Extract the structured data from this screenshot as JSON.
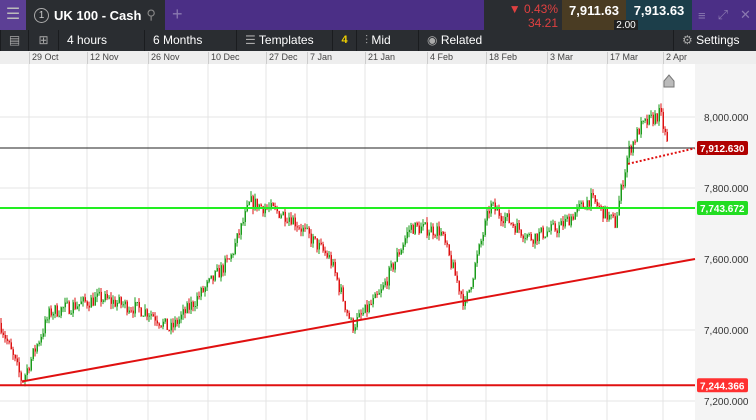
{
  "header": {
    "menu_icon": "hamburger-icon",
    "tab_number": "1",
    "tab_title": "UK 100 - Cash",
    "change_pct": "▼ 0.43%",
    "change_pts": "34.21",
    "sell": "7,911.63",
    "buy": "7,913.63",
    "spread": "2.00"
  },
  "toolbar": {
    "interval": "4 hours",
    "range": "6 Months",
    "templates": "Templates",
    "templates_count": "4",
    "price_type": "Mid",
    "related": "Related",
    "settings": "Settings"
  },
  "dates": [
    "29 Oct",
    "12 Nov",
    "26 Nov",
    "10 Dec",
    "27 Dec",
    "7 Jan",
    "21 Jan",
    "4 Feb",
    "18 Feb",
    "3 Mar",
    "17 Mar",
    "2 Apr"
  ],
  "colors": {
    "up": "#1a9b1a",
    "down": "#d11",
    "support": "#e01010",
    "green_level": "#22ee22",
    "price_tag": "#b00000"
  },
  "chart_data": {
    "type": "candlestick",
    "title": "UK 100 - Cash",
    "ylim": [
      7180,
      8080
    ],
    "yticks": [
      "8,000.000",
      "7,800.000",
      "7,600.000",
      "7,400.000",
      "7,200.000"
    ],
    "ytick_values": [
      8000,
      7800,
      7600,
      7400,
      7200
    ],
    "path_keypoints": [
      [
        0,
        7420
      ],
      [
        22,
        7255
      ],
      [
        50,
        7450
      ],
      [
        100,
        7490
      ],
      [
        150,
        7450
      ],
      [
        170,
        7400
      ],
      [
        200,
        7500
      ],
      [
        230,
        7600
      ],
      [
        250,
        7760
      ],
      [
        290,
        7720
      ],
      [
        330,
        7600
      ],
      [
        352,
        7410
      ],
      [
        380,
        7500
      ],
      [
        410,
        7690
      ],
      [
        440,
        7680
      ],
      [
        465,
        7470
      ],
      [
        490,
        7750
      ],
      [
        530,
        7660
      ],
      [
        560,
        7690
      ],
      [
        590,
        7770
      ],
      [
        615,
        7700
      ],
      [
        628,
        7900
      ],
      [
        640,
        7970
      ],
      [
        660,
        8010
      ],
      [
        668,
        7912
      ]
    ],
    "levels": [
      {
        "label": "7,912.630",
        "value": 7912.63,
        "kind": "current"
      },
      {
        "label": "7,743.672",
        "value": 7743.672,
        "kind": "green"
      },
      {
        "label": "7,244.366",
        "value": 7244.366,
        "kind": "red"
      }
    ],
    "trendline": [
      [
        22,
        7255
      ],
      [
        695,
        7600
      ]
    ],
    "dotted_trendline": [
      [
        628,
        7868
      ],
      [
        695,
        7912
      ]
    ]
  }
}
